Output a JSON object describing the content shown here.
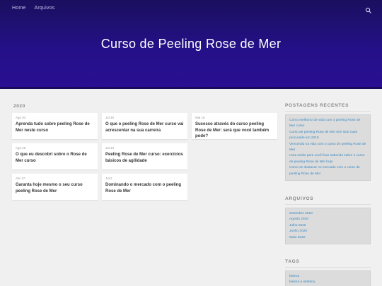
{
  "nav": {
    "home": "Home",
    "archives": "Arquivos"
  },
  "icons": {
    "search": "search-icon"
  },
  "site_title": "Curso de Peeling Rose de Mer",
  "year_heading": "2020",
  "posts": [
    {
      "date": "Ago 03",
      "title": "Aprenda tudo sobre peeling Rose de Mer neste curso"
    },
    {
      "date": "Jul 30",
      "title": "O que o peeling Rose de Mer curso vai acrescentar na sua carreira"
    },
    {
      "date": "Mai 16",
      "title": "Sucesso através do curso peeling Rose de Mer: será que você também pode?"
    },
    {
      "date": "Ago 29",
      "title": "O que eu descobri sobre o Rose de Mer curso"
    },
    {
      "date": "Jul 13",
      "title": "Peeling Rose de Mer curso: exercícios básicos de agilidade"
    },
    {
      "date": "Abr 17",
      "title": "Garanta hoje mesmo o seu curso peeling Rose de Mer"
    },
    {
      "date": "Jul 2",
      "title": "Dominando o mercado com o peeling Rose de Mer"
    }
  ],
  "sidebar": {
    "recent": {
      "title": "POSTAGENS RECENTES",
      "links": [
        "Como melhorar de vida com o peeling Rose de Mer curso",
        "Curso de peeling Rose de Mer tem sido mais procurado em 2019",
        "Vencendo na vida com o curso de peeling Rose de Mer",
        "Uma razão para você ficar sabendo sobre o curso de peeling Rose de Mer hoje",
        "Como se destacar no mercado com o curso de peeling Rose de Mer"
      ]
    },
    "archives": {
      "title": "ARQUIVOS",
      "links": [
        "Setembro 2020",
        "Agosto 2020",
        "Julho 2020",
        "Junho 2020",
        "Maio 2020"
      ]
    },
    "tags": {
      "title": "TAGS",
      "links": [
        "beleza",
        "beleza e estética"
      ]
    }
  },
  "colors": {
    "hero": "#241088",
    "link": "#3a8ac2",
    "background": "#f0f0f0"
  }
}
